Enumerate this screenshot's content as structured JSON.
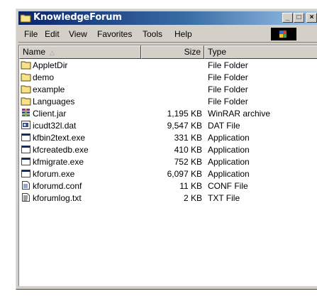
{
  "window": {
    "title": "KnowledgeForum",
    "min_glyph": "_",
    "max_glyph": "□",
    "close_glyph": "×"
  },
  "menu": {
    "file": "File",
    "edit": "Edit",
    "view": "View",
    "favorites": "Favorites",
    "tools": "Tools",
    "help": "Help"
  },
  "columns": {
    "name": "Name",
    "sort_arrow": "△",
    "size": "Size",
    "type": "Type"
  },
  "files": [
    {
      "name": "AppletDir",
      "size": "",
      "type": "File Folder",
      "icon": "folder-icon"
    },
    {
      "name": "demo",
      "size": "",
      "type": "File Folder",
      "icon": "folder-icon"
    },
    {
      "name": "example",
      "size": "",
      "type": "File Folder",
      "icon": "folder-icon"
    },
    {
      "name": "Languages",
      "size": "",
      "type": "File Folder",
      "icon": "folder-icon"
    },
    {
      "name": "Client.jar",
      "size": "1,195 KB",
      "type": "WinRAR archive",
      "icon": "winrar-icon"
    },
    {
      "name": "icudt32l.dat",
      "size": "9,547 KB",
      "type": "DAT File",
      "icon": "dat-file-icon"
    },
    {
      "name": "kfbin2text.exe",
      "size": "331 KB",
      "type": "Application",
      "icon": "application-icon"
    },
    {
      "name": "kfcreatedb.exe",
      "size": "410 KB",
      "type": "Application",
      "icon": "application-icon"
    },
    {
      "name": "kfmigrate.exe",
      "size": "752 KB",
      "type": "Application",
      "icon": "application-icon"
    },
    {
      "name": "kforum.exe",
      "size": "6,097 KB",
      "type": "Application",
      "icon": "application-icon"
    },
    {
      "name": "kforumd.conf",
      "size": "11 KB",
      "type": "CONF File",
      "icon": "conf-file-icon"
    },
    {
      "name": "kforumlog.txt",
      "size": "2 KB",
      "type": "TXT File",
      "icon": "text-file-icon"
    }
  ],
  "colors": {
    "title_start": "#0a246a",
    "title_end": "#a6caf0",
    "chrome": "#d4d0c8",
    "folder": "#f7e28a"
  }
}
